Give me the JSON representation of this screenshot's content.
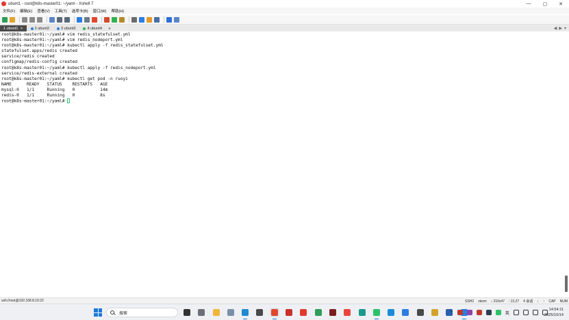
{
  "window": {
    "title": "ubunt1 - root@k8s-master01: ~/yaml - Xshell 7",
    "controls": {
      "minimize": "—",
      "maximize": "▢",
      "close": "✕"
    }
  },
  "menu": [
    {
      "label": "文件(F)"
    },
    {
      "label": "编辑(E)"
    },
    {
      "label": "查看(V)"
    },
    {
      "label": "工具(T)"
    },
    {
      "label": "选项卡(B)"
    },
    {
      "label": "窗口(W)"
    },
    {
      "label": "帮助(H)"
    }
  ],
  "toolbar_icons": [
    {
      "name": "new-session-icon",
      "color": "#2e9c5a"
    },
    {
      "name": "open-folder-icon",
      "color": "#e1a52c"
    },
    {
      "name": "disconnect-icon",
      "color": "#8a8a8a"
    },
    {
      "name": "copy-icon",
      "color": "#8a8a8a"
    },
    {
      "name": "paste-icon",
      "color": "#8a8a8a"
    },
    {
      "name": "find-icon",
      "color": "#5a86c8"
    },
    {
      "name": "print-icon",
      "color": "#5a6a7a"
    },
    {
      "name": "properties-icon",
      "color": "#5a6a7a"
    },
    {
      "name": "globe-icon",
      "color": "#2a7de1"
    },
    {
      "name": "script-icon",
      "color": "#6c7a8a"
    },
    {
      "name": "xftp-icon",
      "color": "#e0472b"
    },
    {
      "name": "xagent-icon",
      "color": "#d24b2a"
    },
    {
      "name": "fullscreen-icon",
      "color": "#2fb350"
    },
    {
      "name": "lock-icon",
      "color": "#b58a2a"
    },
    {
      "name": "keyboard-icon",
      "color": "#6b6b6b"
    },
    {
      "name": "highlight-icon",
      "color": "#2a7de1"
    },
    {
      "name": "compose-icon",
      "color": "#e39a2a"
    },
    {
      "name": "layout-icon",
      "color": "#4a6fa5"
    },
    {
      "name": "help-icon",
      "color": "#2a6fd6"
    },
    {
      "name": "chat-icon",
      "color": "#5a86c8"
    }
  ],
  "tabs": [
    {
      "label": "1 ubunt1",
      "active": true
    },
    {
      "label": "2 ubunt2",
      "active": false
    },
    {
      "label": "3 ubunt3",
      "active": false
    },
    {
      "label": "4 ubunt4",
      "active": false
    }
  ],
  "tab_add": "+",
  "tab_nav": {
    "prev": "◀",
    "next": "▶",
    "menu": "▾"
  },
  "terminal": {
    "lines": [
      "root@k8s-master01:~/yaml# vim redis_statefulset.yml",
      "root@k8s-master01:~/yaml# vim redis_nodeport.yml",
      "root@k8s-master01:~/yaml# kubectl apply -f redis_statefulset.yml",
      "statefulset.apps/redis created",
      "service/redis created",
      "configmap/redis-config created",
      "root@k8s-master01:~/yaml# kubectl apply -f redis_nodeport.yml",
      "service/redis-external created",
      "root@k8s-master01:~/yaml# kubectl get pod -n ruoyi",
      "NAME      READY   STATUS    RESTARTS   AGE",
      "mysql-0   1/1     Running   0          14m",
      "redis-0   1/1     Running   0          8s"
    ],
    "prompt": "root@k8s-master01:~/yaml# "
  },
  "status": {
    "connection": "ssh://root@192.168.8.10:22",
    "protocol": "SSH2",
    "terminal_type": "xterm",
    "size": "↕ 210x47",
    "cursor": "⫶ 13,27",
    "sessions": "4 会话",
    "caps": "CAP",
    "num": "NUM"
  },
  "taskbar": {
    "search_placeholder": "搜索",
    "apps": [
      {
        "name": "taskview-icon",
        "color": "#333333",
        "running": false,
        "selected": false
      },
      {
        "name": "settings-icon",
        "color": "#6a6f78",
        "running": false,
        "selected": false
      },
      {
        "name": "explorer-icon",
        "color": "#f2b53a",
        "running": false,
        "selected": false
      },
      {
        "name": "app-snail-icon",
        "color": "#7a8fa8",
        "running": false,
        "selected": false
      },
      {
        "name": "vscode-icon",
        "color": "#1f8ad2",
        "running": true,
        "selected": false
      },
      {
        "name": "app-tool-icon",
        "color": "#4a4a4a",
        "running": false,
        "selected": false
      },
      {
        "name": "xshell-icon",
        "color": "#e0472b",
        "running": true,
        "selected": true
      },
      {
        "name": "app-red-icon",
        "color": "#c8322a",
        "running": false,
        "selected": false
      },
      {
        "name": "app-redbox-icon",
        "color": "#e03a2f",
        "running": false,
        "selected": false
      },
      {
        "name": "app-green-icon",
        "color": "#2e9c5a",
        "running": false,
        "selected": false
      },
      {
        "name": "app-dark-icon",
        "color": "#7a2020",
        "running": false,
        "selected": false
      },
      {
        "name": "chrome-icon",
        "color": "#e8453c",
        "running": false,
        "selected": false
      },
      {
        "name": "edge-icon",
        "color": "#1a9a8a",
        "running": false,
        "selected": false
      },
      {
        "name": "wechat-icon",
        "color": "#2dc16a",
        "running": true,
        "selected": false
      },
      {
        "name": "app-bluegreen-icon",
        "color": "#1c8bd8",
        "running": false,
        "selected": false
      },
      {
        "name": "app-bird-icon",
        "color": "#2a7de1",
        "running": false,
        "selected": false
      },
      {
        "name": "app-cube-icon",
        "color": "#4a4a4a",
        "running": false,
        "selected": false
      },
      {
        "name": "app-yellowframe-icon",
        "color": "#d4a22a",
        "running": false,
        "selected": false
      },
      {
        "name": "app-bluescreen-icon",
        "color": "#2a5fb0",
        "running": false,
        "selected": false
      },
      {
        "name": "app-v-icon",
        "color": "#2a7de1",
        "running": true,
        "selected": false
      }
    ],
    "tray": {
      "chevron": "^",
      "icons": [
        {
          "name": "tray-app1-icon",
          "color": "#c0392b"
        },
        {
          "name": "tray-app2-icon",
          "color": "#8e44ad"
        },
        {
          "name": "tray-app3-icon",
          "color": "#c0392b"
        },
        {
          "name": "tray-app4-icon",
          "color": "#2c3e50"
        },
        {
          "name": "tray-wechat-icon",
          "color": "#2dc16a"
        }
      ],
      "lang": "英",
      "extra_icons": [
        {
          "name": "grid-icon",
          "color": "#333333"
        },
        {
          "name": "wifi-icon",
          "color": "#333333"
        },
        {
          "name": "volume-icon",
          "color": "#333333"
        },
        {
          "name": "battery-icon",
          "color": "#333333"
        }
      ]
    },
    "time": "14:54:11",
    "date": "2025/10/14"
  }
}
